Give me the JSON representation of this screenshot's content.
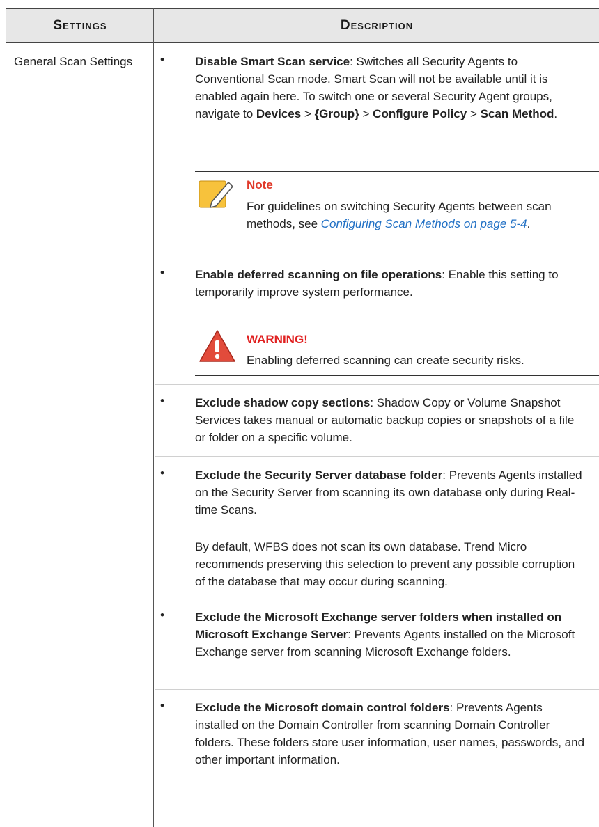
{
  "header": {
    "col_settings": "Settings",
    "col_description": "Description"
  },
  "setting_name": "General Scan Settings",
  "items": [
    {
      "title": "Disable Smart Scan service",
      "text_before": ": Switches all Security Agents to Conventional Scan mode. Smart Scan will not be available until it is enabled again here. To switch one or several Security Agent groups, navigate to ",
      "nav1": "Devices",
      "nav_sep1": " > ",
      "nav2": "{Group}",
      "nav_sep2": " > ",
      "nav3": "Configure Policy",
      "nav_sep3": " > ",
      "nav4": "Scan Method",
      "end": "."
    },
    {
      "title": "Enable deferred scanning on file operations",
      "text": ": Enable this setting to temporarily improve system performance."
    },
    {
      "title": "Exclude shadow copy sections",
      "text": ": Shadow Copy or Volume Snapshot Services takes manual or automatic backup copies or snapshots of a file or folder on a specific volume."
    },
    {
      "title": "Exclude the Security Server database folder",
      "text": ": Prevents Agents installed on the Security Server from scanning its own database only during Real-time Scans.",
      "extra": "By default, WFBS does not scan its own database. Trend Micro recommends preserving this selection to prevent any possible corruption of the database that may occur during scanning."
    },
    {
      "title": "Exclude the Microsoft Exchange server folders when installed on Microsoft Exchange Server",
      "text": ": Prevents Agents installed on the Microsoft Exchange server from scanning Microsoft Exchange folders."
    },
    {
      "title": "Exclude the Microsoft domain control folders",
      "text": ": Prevents Agents installed on the Domain Controller from scanning Domain Controller folders. These folders store user information, user names, passwords, and other important information."
    }
  ],
  "note": {
    "title": "Note",
    "text_before": "For guidelines on switching Security Agents between scan methods, see ",
    "link": "Configuring Scan Methods on page 5-4",
    "end": "."
  },
  "warning": {
    "title": "WARNING!",
    "text": "Enabling deferred scanning can create security risks."
  },
  "bullet": "•"
}
